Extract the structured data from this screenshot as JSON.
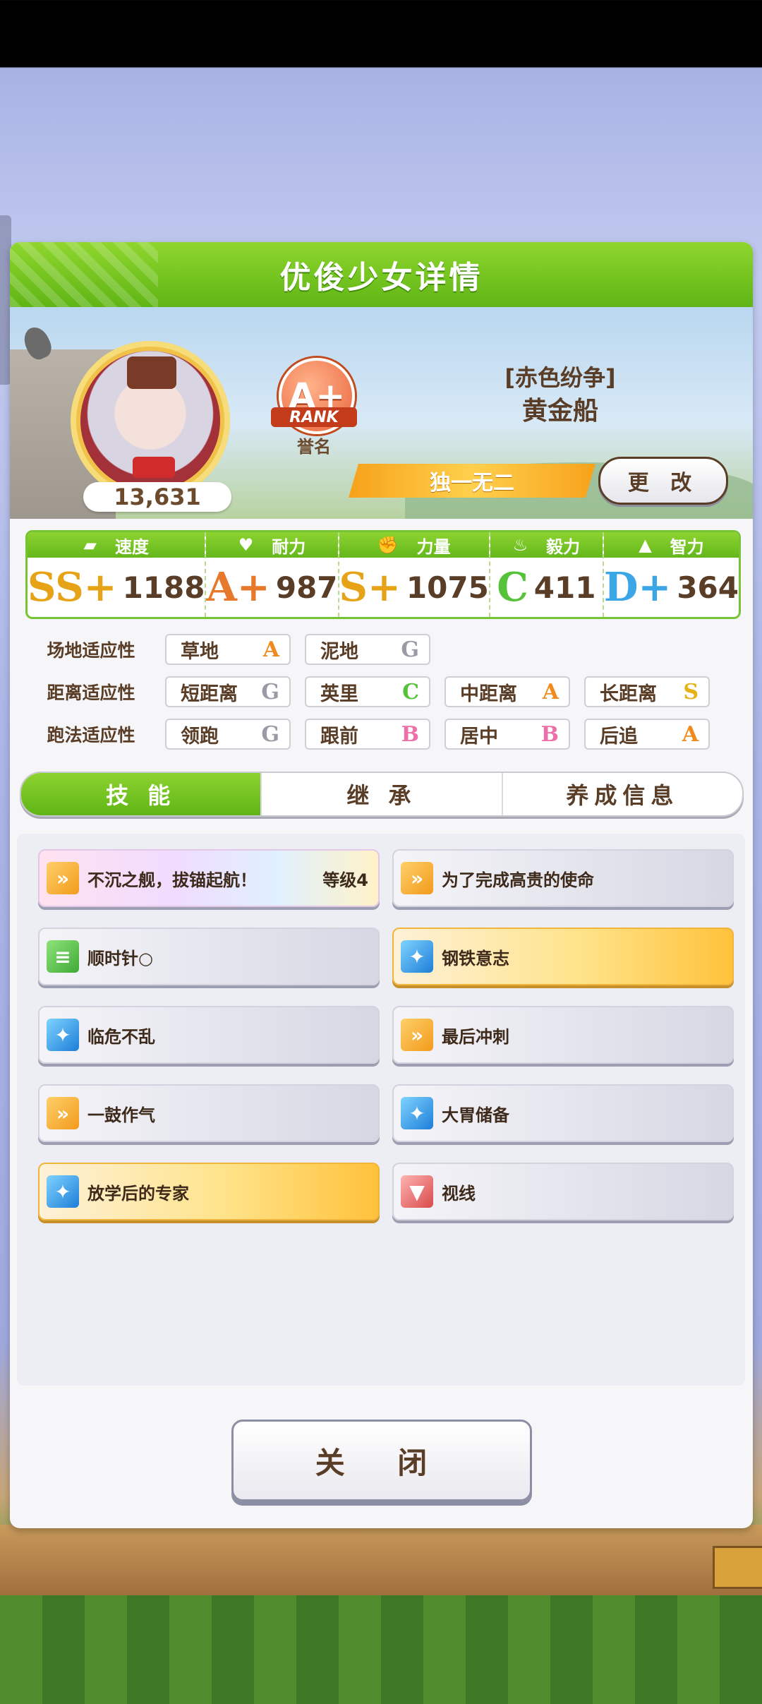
{
  "panel": {
    "title": "优俊少女详情"
  },
  "profile": {
    "power": "13,631",
    "rank_letter": "A+",
    "rank_word": "RANK",
    "rank_label": "誉名",
    "outfit_title": "[赤色纷争]",
    "name": "黄金船",
    "epithet": "独一无二",
    "change_label": "更 改"
  },
  "stats": [
    {
      "label": "速度",
      "icon": "shoe-icon",
      "glyph": "⬛",
      "grade": "SS+",
      "value": "1188",
      "color": "#e6a317"
    },
    {
      "label": "耐力",
      "icon": "heart-icon",
      "glyph": "♥",
      "grade": "A+",
      "value": "987",
      "color": "#e6792b"
    },
    {
      "label": "力量",
      "icon": "muscle-icon",
      "glyph": "💪",
      "grade": "S+",
      "value": "1075",
      "color": "#e6a317"
    },
    {
      "label": "毅力",
      "icon": "flame-icon",
      "glyph": "🔥",
      "grade": "C",
      "value": "411",
      "color": "#56c23a"
    },
    {
      "label": "智力",
      "icon": "graduation-cap-icon",
      "glyph": "🎓",
      "grade": "D+",
      "value": "364",
      "color": "#3aa6e6"
    }
  ],
  "aptitude": {
    "track": {
      "label": "场地适应性",
      "items": [
        {
          "name": "草地",
          "grade": "A",
          "color": "#f08a1c"
        },
        {
          "name": "泥地",
          "grade": "G",
          "color": "#9a9aa6"
        }
      ]
    },
    "distance": {
      "label": "距离适应性",
      "items": [
        {
          "name": "短距离",
          "grade": "G",
          "color": "#9a9aa6"
        },
        {
          "name": "英里",
          "grade": "C",
          "color": "#56c23a"
        },
        {
          "name": "中距离",
          "grade": "A",
          "color": "#f08a1c"
        },
        {
          "name": "长距离",
          "grade": "S",
          "color": "#e6b317"
        }
      ]
    },
    "style": {
      "label": "跑法适应性",
      "items": [
        {
          "name": "领跑",
          "grade": "G",
          "color": "#9a9aa6"
        },
        {
          "name": "跟前",
          "grade": "B",
          "color": "#ee6fa8"
        },
        {
          "name": "居中",
          "grade": "B",
          "color": "#ee6fa8"
        },
        {
          "name": "后追",
          "grade": "A",
          "color": "#f08a1c"
        }
      ]
    }
  },
  "tabs": [
    "技 能",
    "继 承",
    "养成信息"
  ],
  "skills": [
    {
      "name": "不沉之舰，拔锚起航！",
      "level": "等级4",
      "icon": "running-horse-icon",
      "style": "rainbow"
    },
    {
      "name": "为了完成高贵的使命",
      "level": "",
      "icon": "running-horse-icon",
      "style": ""
    },
    {
      "name": "顺时针○",
      "level": "",
      "icon": "recovery-icon",
      "style": ""
    },
    {
      "name": "钢铁意志",
      "level": "",
      "icon": "sparkle-icon",
      "style": "gold"
    },
    {
      "name": "临危不乱",
      "level": "",
      "icon": "sparkle-icon",
      "style": ""
    },
    {
      "name": "最后冲刺",
      "level": "",
      "icon": "running-horse-icon",
      "style": ""
    },
    {
      "name": "一鼓作气",
      "level": "",
      "icon": "running-horse-icon",
      "style": ""
    },
    {
      "name": "大胃储备",
      "level": "",
      "icon": "sparkle-icon",
      "style": ""
    },
    {
      "name": "放学后的专家",
      "level": "",
      "icon": "sparkle-icon",
      "style": "gold"
    },
    {
      "name": "视线",
      "level": "",
      "icon": "debuff-horse-icon",
      "style": ""
    }
  ],
  "close_label": "关 闭"
}
